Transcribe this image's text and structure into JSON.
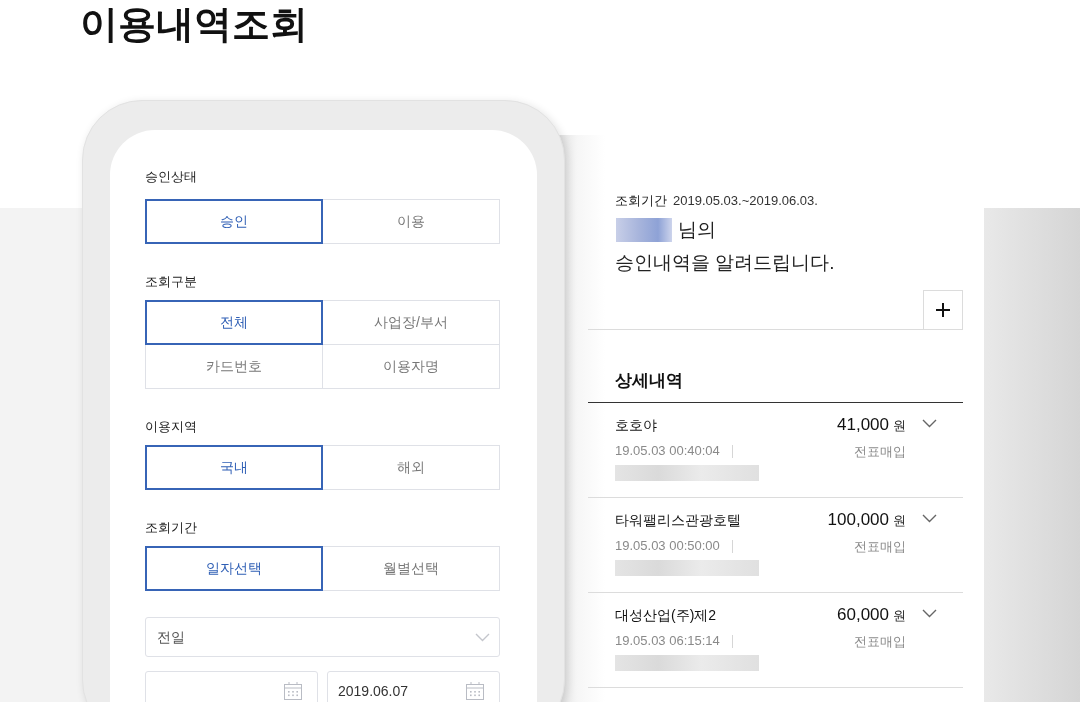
{
  "page": {
    "title": "이용내역조회"
  },
  "filters": [
    {
      "label": "승인상태",
      "options": [
        {
          "label": "승인",
          "selected": true
        },
        {
          "label": "이용",
          "selected": false
        }
      ]
    },
    {
      "label": "조회구분",
      "options": [
        {
          "label": "전체",
          "selected": true
        },
        {
          "label": "사업장/부서",
          "selected": false
        },
        {
          "label": "카드번호",
          "selected": false
        },
        {
          "label": "이용자명",
          "selected": false
        }
      ]
    },
    {
      "label": "이용지역",
      "options": [
        {
          "label": "국내",
          "selected": true
        },
        {
          "label": "해외",
          "selected": false
        }
      ]
    },
    {
      "label": "조회기간",
      "options": [
        {
          "label": "일자선택",
          "selected": true
        },
        {
          "label": "월별선택",
          "selected": false
        }
      ]
    }
  ],
  "period_select": {
    "value": "전일"
  },
  "date_range": {
    "end": "2019.06.07"
  },
  "summary": {
    "period_label": "조회기간",
    "period": "2019.05.03.~2019.06.03.",
    "greeting_suffix": "님의",
    "message": "승인내역을 알려드립니다."
  },
  "details": {
    "title": "상세내역",
    "items": [
      {
        "merchant": "호호야",
        "amount": "41,000",
        "currency": "원",
        "datetime": "19.05.03 00:40:04",
        "status": "전표매입"
      },
      {
        "merchant": "타워팰리스관광호텔",
        "amount": "100,000",
        "currency": "원",
        "datetime": "19.05.03 00:50:00",
        "status": "전표매입"
      },
      {
        "merchant": "대성산업(주)제2",
        "amount": "60,000",
        "currency": "원",
        "datetime": "19.05.03 06:15:14",
        "status": "전표매입"
      }
    ]
  }
}
